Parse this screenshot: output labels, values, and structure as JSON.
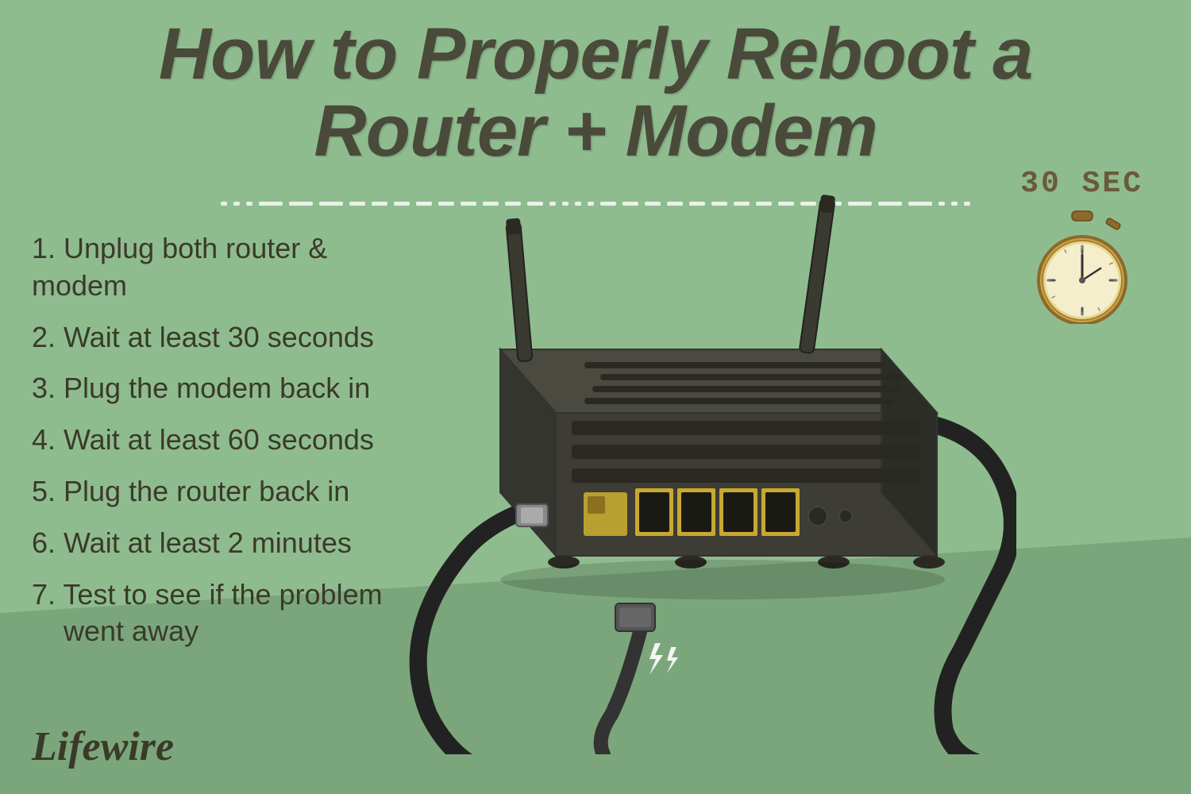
{
  "title": {
    "line1": "How to Properly Reboot a",
    "line2": "Router + Modem"
  },
  "steps": [
    {
      "number": "1.",
      "text": "Unplug both router & modem"
    },
    {
      "number": "2.",
      "text": "Wait at least 30 seconds"
    },
    {
      "number": "3.",
      "text": "Plug the modem back in"
    },
    {
      "number": "4.",
      "text": "Wait at least 60 seconds"
    },
    {
      "number": "5.",
      "text": "Plug the router back in"
    },
    {
      "number": "6.",
      "text": "Wait at least 2 minutes"
    },
    {
      "number": "7.",
      "text": "Test to see if the problem",
      "text2": "went away"
    }
  ],
  "timer": {
    "label": "30 SEC"
  },
  "brand": {
    "name": "Lifewire"
  },
  "colors": {
    "background": "#8fbc8f",
    "title": "#4a4a3a",
    "steps": "#3a3a2a",
    "timer": "#6a5a3a",
    "router_body": "#3a3a32",
    "router_dark": "#2a2a22"
  }
}
